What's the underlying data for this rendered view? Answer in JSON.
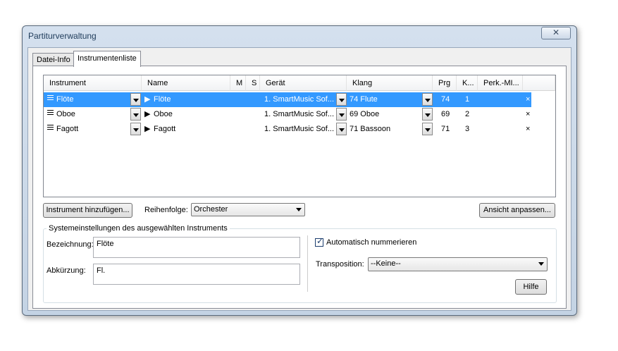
{
  "window": {
    "title": "Partiturverwaltung",
    "close_glyph": "✕"
  },
  "tabs": [
    {
      "label": "Datei-Info",
      "active": false
    },
    {
      "label": "Instrumentenliste",
      "active": true
    }
  ],
  "grid": {
    "columns": [
      "Instrument",
      "Name",
      "M",
      "S",
      "Gerät",
      "Klang",
      "Prg",
      "K...",
      "Perk.-MI..."
    ],
    "rows": [
      {
        "instrument": "Flöte",
        "name": "Flöte",
        "geraet": "1. SmartMusic Sof...",
        "klang": "74 Flute",
        "prg": "74",
        "k": "1",
        "remove": "×",
        "selected": true
      },
      {
        "instrument": "Oboe",
        "name": "Oboe",
        "geraet": "1. SmartMusic Sof...",
        "klang": "69 Oboe",
        "prg": "69",
        "k": "2",
        "remove": "×",
        "selected": false
      },
      {
        "instrument": "Fagott",
        "name": "Fagott",
        "geraet": "1. SmartMusic Sof...",
        "klang": "71 Bassoon",
        "prg": "71",
        "k": "3",
        "remove": "×",
        "selected": false
      }
    ],
    "expand_glyph": "▶",
    "selection_color": "#3399ff"
  },
  "controls": {
    "add_instrument": "Instrument hinzufügen...",
    "order_label": "Reihenfolge:",
    "order_value": "Orchester",
    "customize_view": "Ansicht anpassen..."
  },
  "settings": {
    "group_label": "Systemeinstellungen des ausgewählten Instruments",
    "name_label": "Bezeichnung:",
    "name_value": "Flöte",
    "abbr_label": "Abkürzung:",
    "abbr_value": "Fl.",
    "auto_number_label": "Automatisch nummerieren",
    "auto_number_checked": true,
    "transposition_label": "Transposition:",
    "transposition_value": "--Keine--",
    "help": "Hilfe"
  }
}
